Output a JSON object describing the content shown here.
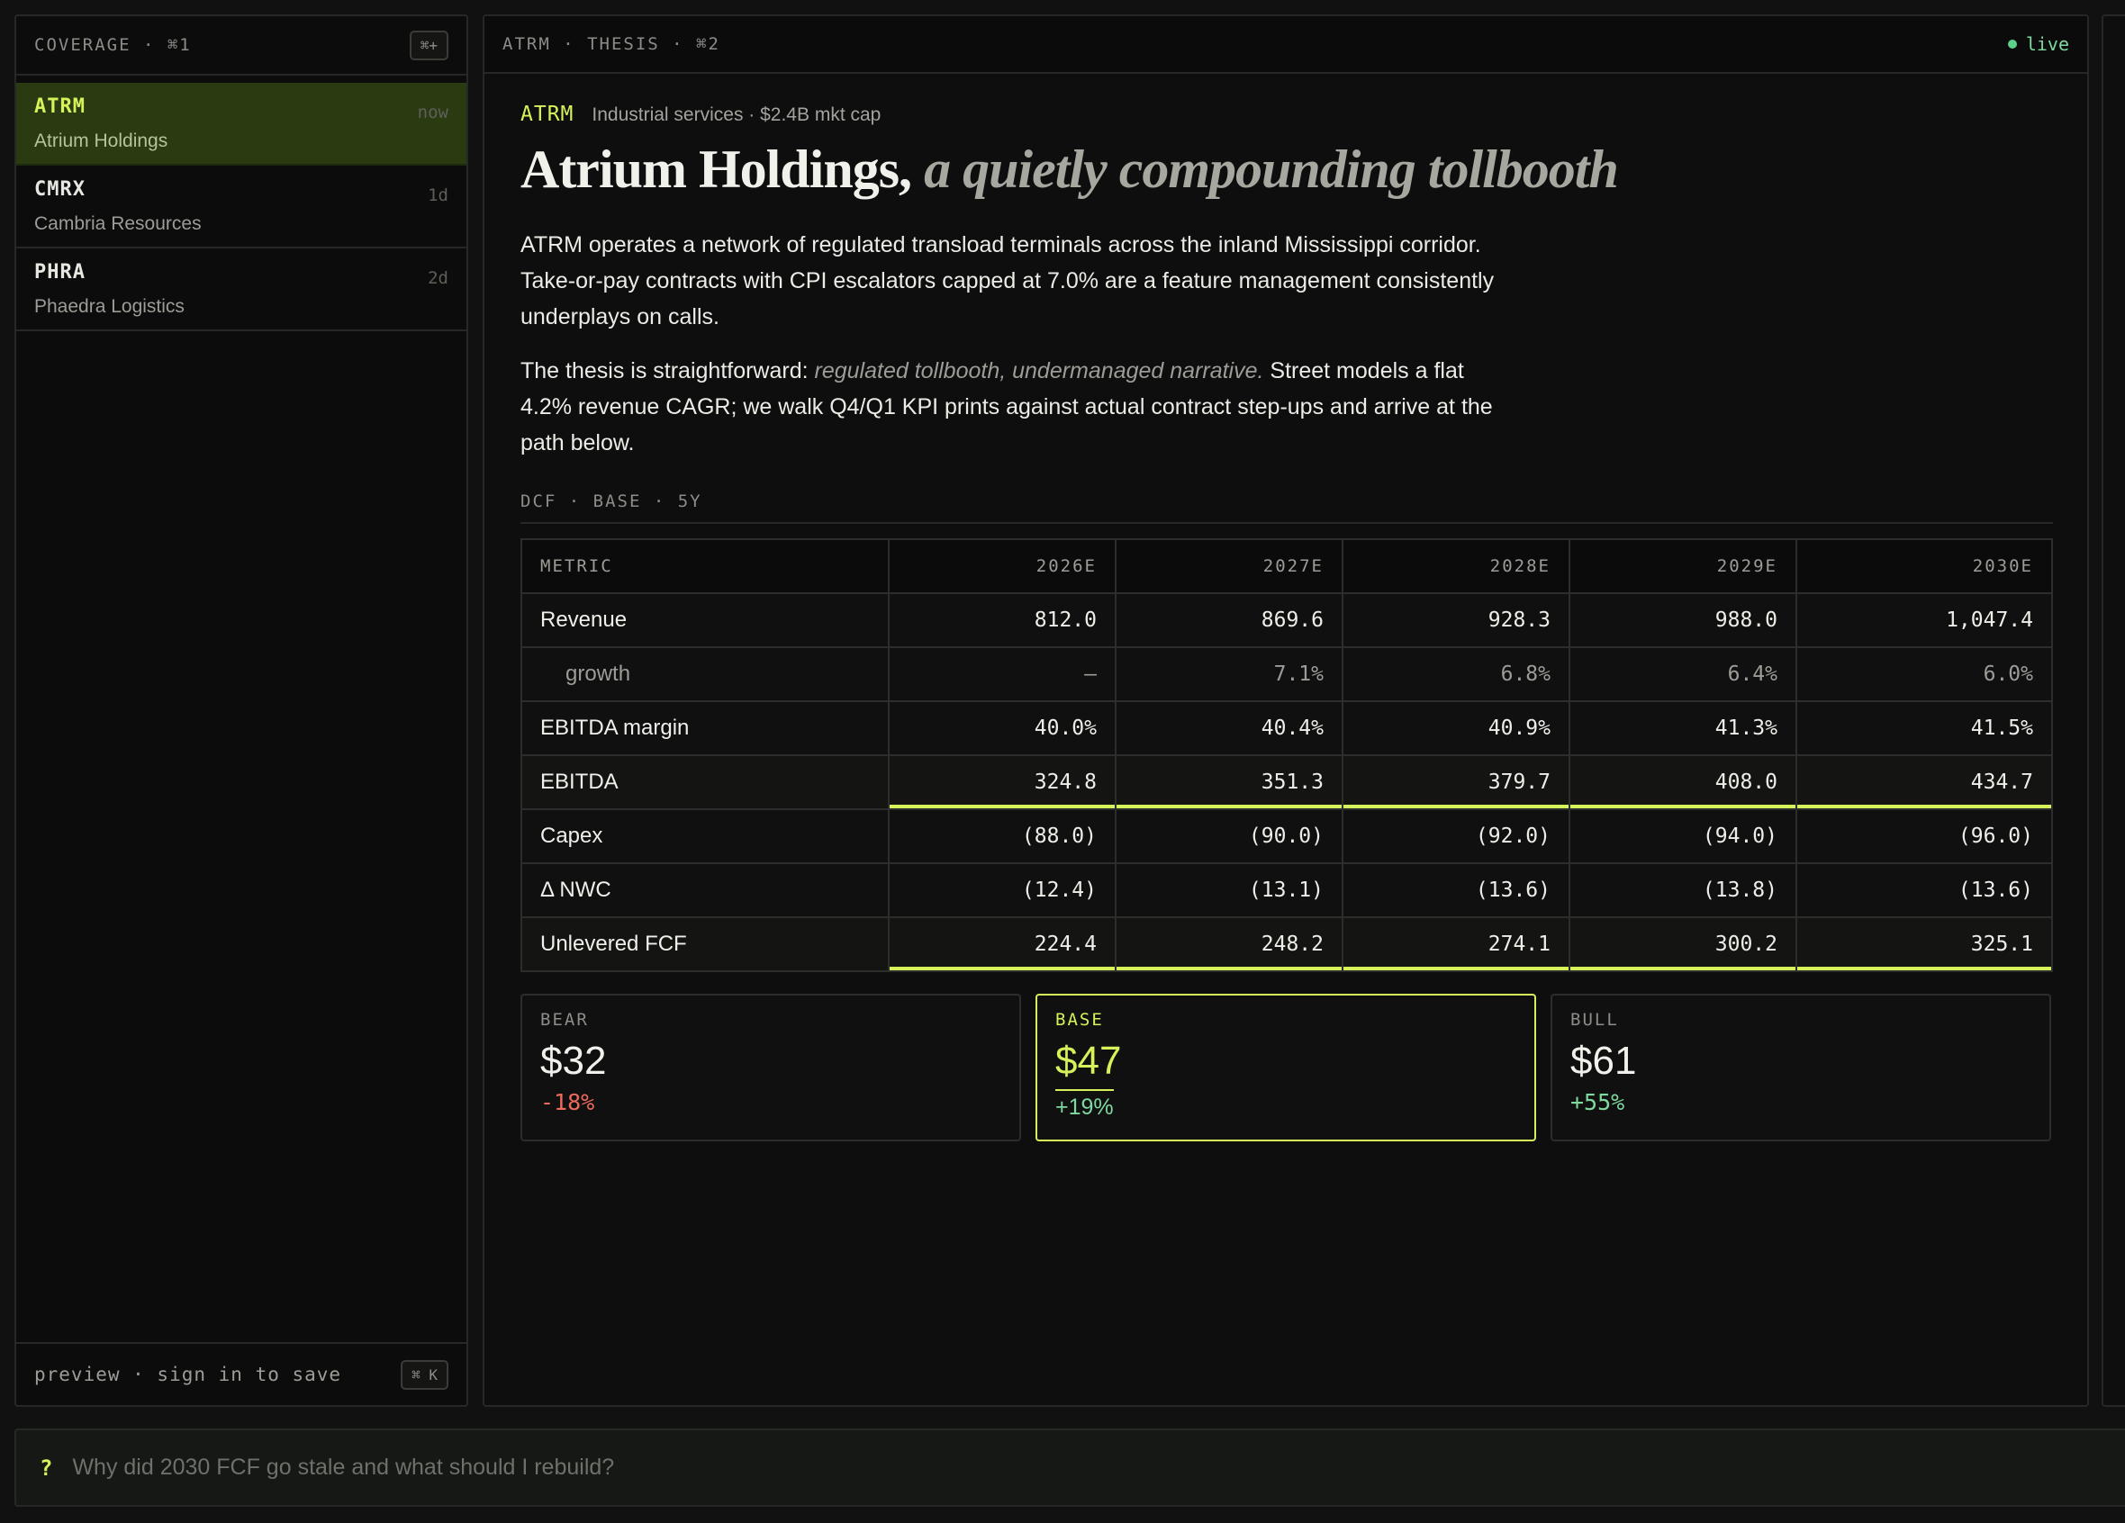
{
  "coverage": {
    "title": "COVERAGE · ⌘1",
    "add_shortcut": "⌘+",
    "items": [
      {
        "ticker": "ATRM",
        "name": "Atrium Holdings",
        "age": "now"
      },
      {
        "ticker": "CMRX",
        "name": "Cambria Resources",
        "age": "1d"
      },
      {
        "ticker": "PHRA",
        "name": "Phaedra Logistics",
        "age": "2d"
      }
    ],
    "footer_text": "preview · sign in to save",
    "footer_shortcut": "⌘ K"
  },
  "thesis": {
    "breadcrumb": "ATRM · THESIS · ⌘2",
    "status": "live",
    "ticker": "ATRM",
    "sector": "Industrial services · $2.4B mkt cap",
    "title_main": "Atrium Holdings,",
    "title_italic": "a quietly compounding tollbooth",
    "para1": "ATRM operates a network of regulated transload terminals across the inland Mississippi corridor. Take-or-pay contracts with CPI escalators capped at 7.0% are a feature management consistently underplays on calls.",
    "para2_lead": "The thesis is straightforward: ",
    "para2_em": "regulated tollbooth, undermanaged narrative.",
    "para2_rest": " Street models a flat 4.2% revenue CAGR; we walk Q4/Q1 KPI prints against actual contract step-ups and arrive at the path below.",
    "dcf_label": "DCF · BASE · 5Y",
    "table": {
      "headers": [
        "METRIC",
        "2026E",
        "2027E",
        "2028E",
        "2029E",
        "2030E"
      ],
      "rows": [
        {
          "label": "Revenue",
          "values": [
            "812.0",
            "869.6",
            "928.3",
            "988.0",
            "1,047.4"
          ]
        },
        {
          "label": "growth",
          "values": [
            "—",
            "7.1%",
            "6.8%",
            "6.4%",
            "6.0%"
          ]
        },
        {
          "label": "EBITDA margin",
          "values": [
            "40.0%",
            "40.4%",
            "40.9%",
            "41.3%",
            "41.5%"
          ]
        },
        {
          "label": "EBITDA",
          "values": [
            "324.8",
            "351.3",
            "379.7",
            "408.0",
            "434.7"
          ]
        },
        {
          "label": "Capex",
          "values": [
            "(88.0)",
            "(90.0)",
            "(92.0)",
            "(94.0)",
            "(96.0)"
          ]
        },
        {
          "label": "Δ NWC",
          "values": [
            "(12.4)",
            "(13.1)",
            "(13.6)",
            "(13.8)",
            "(13.6)"
          ]
        },
        {
          "label": "Unlevered FCF",
          "values": [
            "224.4",
            "248.2",
            "274.1",
            "300.2",
            "325.1"
          ]
        }
      ]
    },
    "scenarios": [
      {
        "tag": "BEAR",
        "price": "$32",
        "change": "-18%"
      },
      {
        "tag": "BASE",
        "price": "$47",
        "change": "+19%"
      },
      {
        "tag": "BULL",
        "price": "$61",
        "change": "+55%"
      }
    ]
  },
  "prompt": {
    "marker": "?",
    "placeholder": "Why did 2030 FCF go stale and what should I rebuild?"
  },
  "colors": {
    "accent": "#d6f25a",
    "positive": "#7fd8a0",
    "negative": "#ee6a5a",
    "background": "#101110"
  }
}
